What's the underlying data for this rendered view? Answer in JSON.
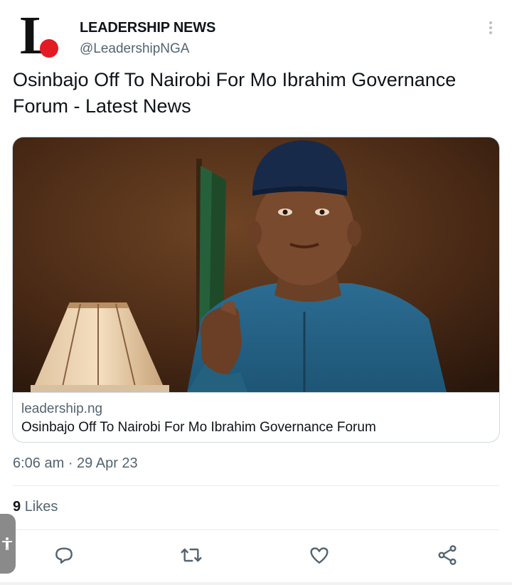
{
  "author": {
    "name": "LEADERSHIP NEWS",
    "handle": "@LeadershipNGA",
    "logo_letter": "L",
    "logo_dot_color": "#e21b25"
  },
  "tweet": {
    "text": "Osinbajo Off To Nairobi For Mo Ibrahim Governance Forum - Latest News"
  },
  "card": {
    "domain": "leadership.ng",
    "title": "Osinbajo Off To Nairobi For Mo Ibrahim Governance Forum",
    "image_description_icon": "photo-of-man-in-blue-cap"
  },
  "meta": {
    "timestamp": "6:06 am · 29 Apr 23",
    "likes_count": "9",
    "likes_label": "Likes"
  },
  "actions": {
    "icons": [
      "reply-icon",
      "retweet-icon",
      "like-icon",
      "share-icon"
    ]
  },
  "colors": {
    "text_primary": "#0f1419",
    "text_secondary": "#536471",
    "border": "#cfd9de"
  }
}
